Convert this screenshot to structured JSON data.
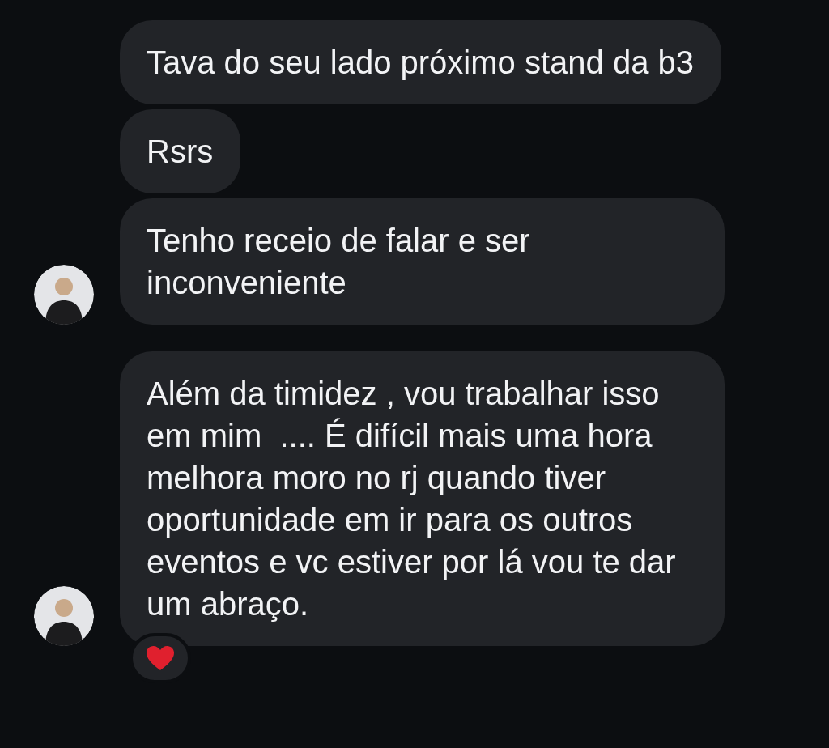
{
  "messages": [
    {
      "text": "Tava do seu lado próximo stand da b3",
      "avatar": false
    },
    {
      "text": "Rsrs",
      "avatar": false
    },
    {
      "text": "Tenho receio de falar e ser inconveniente",
      "avatar": true
    },
    {
      "text": "Além da timidez , vou trabalhar isso em mim  .... É difícil mais uma hora melhora moro no rj quando tiver oportunidade em ir para os outros eventos e vc estiver por lá vou te dar um abraço.",
      "avatar": true,
      "reaction": {
        "kind": "heart"
      }
    }
  ]
}
